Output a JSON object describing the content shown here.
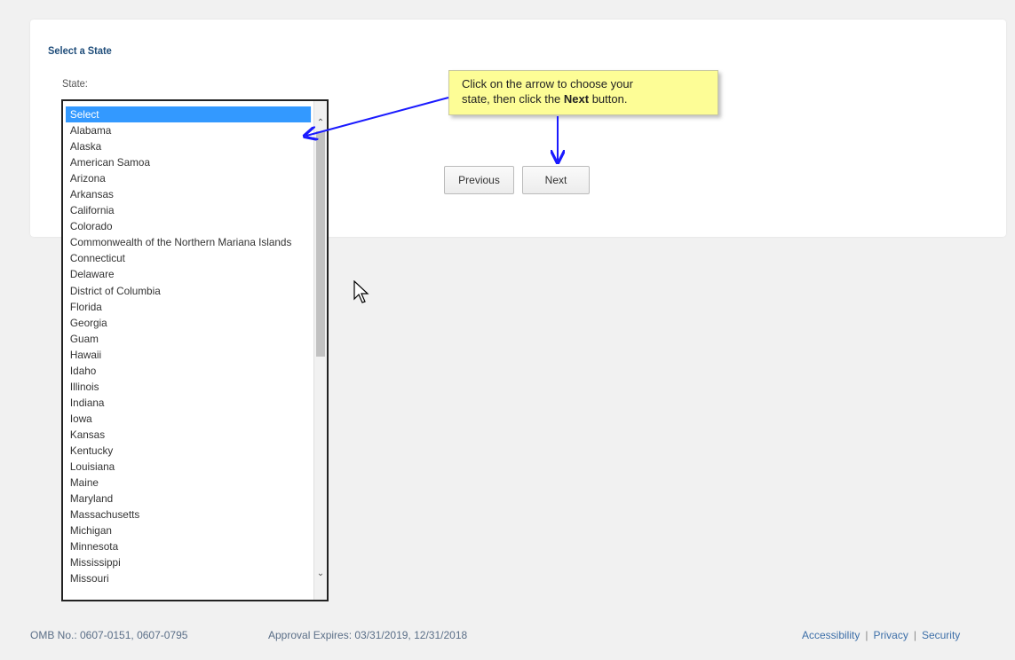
{
  "form": {
    "section_title": "Select a State",
    "state_label": "State:",
    "options": [
      "Select",
      "Alabama",
      "Alaska",
      "American Samoa",
      "Arizona",
      "Arkansas",
      "California",
      "Colorado",
      "Commonwealth of the Northern Mariana Islands",
      "Connecticut",
      "Delaware",
      "District of Columbia",
      "Florida",
      "Georgia",
      "Guam",
      "Hawaii",
      "Idaho",
      "Illinois",
      "Indiana",
      "Iowa",
      "Kansas",
      "Kentucky",
      "Louisiana",
      "Maine",
      "Maryland",
      "Massachusetts",
      "Michigan",
      "Minnesota",
      "Mississippi",
      "Missouri"
    ],
    "selected_option": "Select"
  },
  "buttons": {
    "previous_label": "Previous",
    "next_label": "Next"
  },
  "callout": {
    "text_line1": "Click on the arrow to choose your",
    "text_line2_before": "state, then click the ",
    "text_line2_bold": "Next",
    "text_line2_after": " button."
  },
  "footer": {
    "omb_text": "OMB No.: 0607-0151, 0607-0795",
    "approval_text": "Approval Expires: 03/31/2019, 12/31/2018",
    "links": [
      "Accessibility",
      "Privacy",
      "Security"
    ]
  },
  "colors": {
    "selected_background": "#3399ff",
    "callout_background": "#fdfd96",
    "arrow": "#1a1aff"
  }
}
